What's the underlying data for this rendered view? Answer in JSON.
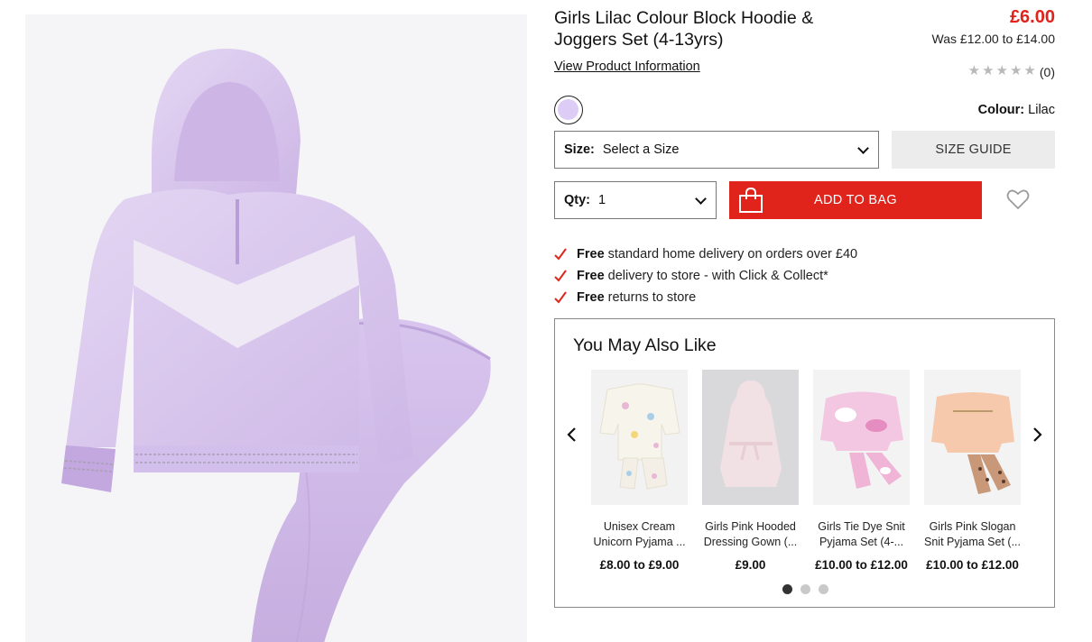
{
  "product": {
    "title_line1": "Girls Lilac Colour Block Hoodie &",
    "title_line2": "Joggers Set (4-13yrs)",
    "price": "£6.00",
    "was_price": "Was £12.00 to £14.00",
    "view_info": "View Product Information",
    "review_count": "(0)",
    "stars": 5,
    "stars_filled": 0,
    "colour_label": "Colour:",
    "colour_value": "Lilac",
    "colour_hex": "#dcccf6"
  },
  "form": {
    "size_label": "Size:",
    "size_value": "Select a Size",
    "size_guide": "SIZE GUIDE",
    "qty_label": "Qty:",
    "qty_value": "1",
    "add_to_bag": "ADD TO BAG"
  },
  "delivery": [
    {
      "bold": "Free",
      "text": "standard home delivery on orders over £40"
    },
    {
      "bold": "Free",
      "text": "delivery to store - with Click & Collect*"
    },
    {
      "bold": "Free",
      "text": "returns to store"
    }
  ],
  "ymal": {
    "title": "You May Also Like",
    "items": [
      {
        "line1": "Unisex Cream",
        "line2": "Unicorn Pyjama ...",
        "price": "£8.00 to £9.00"
      },
      {
        "line1": "Girls Pink Hooded",
        "line2": "Dressing Gown (...",
        "price": "£9.00"
      },
      {
        "line1": "Girls Tie Dye Snit",
        "line2": "Pyjama Set (4-...",
        "price": "£10.00 to £12.00"
      },
      {
        "line1": "Girls Pink Slogan",
        "line2": "Snit Pyjama Set (...",
        "price": "£10.00 to £12.00"
      }
    ],
    "pages": 3,
    "active_page": 1
  },
  "colors": {
    "accent_red": "#e0241c",
    "lilac": "#d9c6ef",
    "guide_bg": "#ececec"
  },
  "icons": [
    "shopping-bag-icon",
    "heart-icon",
    "star-icon",
    "tick-icon",
    "chevron-left-icon",
    "chevron-right-icon",
    "chevron-down-icon"
  ]
}
